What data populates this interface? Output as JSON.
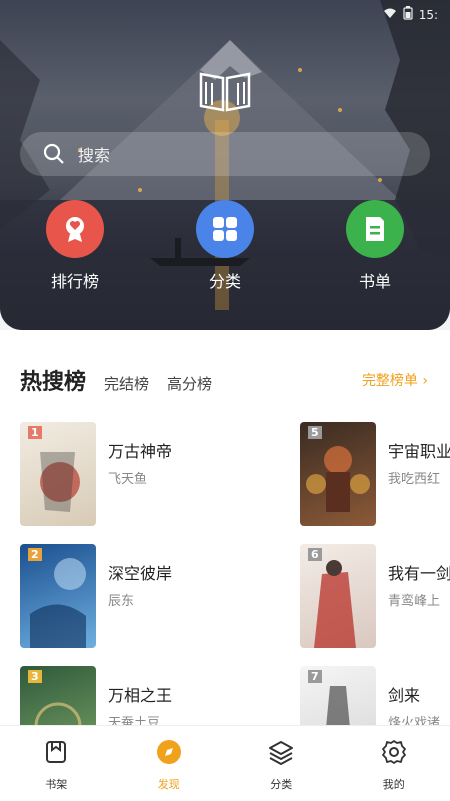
{
  "status_bar": {
    "time": "15:"
  },
  "search": {
    "label": "搜索"
  },
  "quick_actions": [
    {
      "label": "排行榜",
      "icon": "ranking-icon",
      "color": "#e8564b"
    },
    {
      "label": "分类",
      "icon": "category-icon",
      "color": "#4a84e8"
    },
    {
      "label": "书单",
      "icon": "booklist-icon",
      "color": "#3cb24c"
    }
  ],
  "tabs": {
    "active": "热搜榜",
    "items": [
      "完结榜",
      "高分榜"
    ],
    "full_list": "完整榜单 ›"
  },
  "books": [
    {
      "rank": "1",
      "title": "万古神帝",
      "author": "飞天鱼"
    },
    {
      "rank": "2",
      "title": "深空彼岸",
      "author": "辰东"
    },
    {
      "rank": "3",
      "title": "万相之王",
      "author": "天蚕土豆"
    },
    {
      "rank": "5",
      "title": "宇宙职业",
      "author": "我吃西红"
    },
    {
      "rank": "6",
      "title": "我有一剑",
      "author": "青鸾峰上"
    },
    {
      "rank": "7",
      "title": "剑来",
      "author": "烽火戏诸"
    }
  ],
  "nav": [
    {
      "label": "书架",
      "icon": "bookshelf-icon"
    },
    {
      "label": "发现",
      "icon": "discover-icon",
      "active": true
    },
    {
      "label": "分类",
      "icon": "layers-icon"
    },
    {
      "label": "我的",
      "icon": "settings-icon"
    }
  ],
  "colors": {
    "accent": "#f0a21c"
  }
}
